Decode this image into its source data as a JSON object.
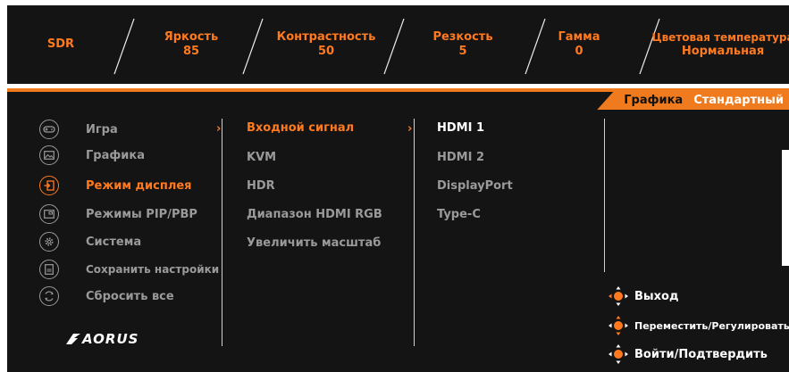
{
  "status": {
    "sdr": "SDR",
    "brightness_label": "Яркость",
    "brightness_value": "85",
    "contrast_label": "Контрастность",
    "contrast_value": "50",
    "sharpness_label": "Резкость",
    "sharpness_value": "5",
    "gamma_label": "Гамма",
    "gamma_value": "0",
    "color_temp_label": "Цветовая температура",
    "color_temp_value": "Нормальная"
  },
  "tabs": {
    "left": "Графика",
    "right": "Стандартный"
  },
  "menu": {
    "items": [
      {
        "label": "Игра",
        "icon": "gamepad-icon"
      },
      {
        "label": "Графика",
        "icon": "image-icon"
      },
      {
        "label": "Режим дисплея",
        "icon": "input-icon"
      },
      {
        "label": "Режимы PIP/PBP",
        "icon": "pip-icon"
      },
      {
        "label": "Система",
        "icon": "gear-icon"
      },
      {
        "label": "Сохранить настройки",
        "icon": "save-icon"
      },
      {
        "label": "Сбросить все",
        "icon": "reset-icon"
      }
    ],
    "active_index": 2
  },
  "submenu": {
    "items": [
      "Входной сигнал",
      "KVM",
      "HDR",
      "Диапазон HDMI RGB",
      "Увеличить масштаб"
    ],
    "active_index": 0
  },
  "options": {
    "items": [
      "HDMI 1",
      "HDMI 2",
      "DisplayPort",
      "Type-C"
    ],
    "selected_index": 0
  },
  "help": {
    "exit": "Выход",
    "move": "Переместить/Регулировать",
    "enter": "Войти/Подтвердить"
  },
  "brand": {
    "logo_text": "AORUS"
  },
  "colors": {
    "accent": "#f07a1e",
    "panel": "#141414",
    "text_muted": "#9a9a9a"
  }
}
